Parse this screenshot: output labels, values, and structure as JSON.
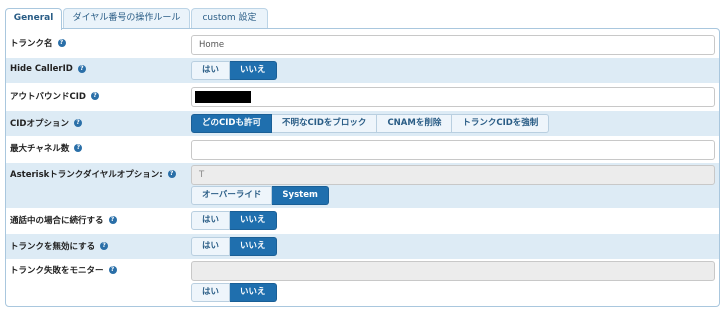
{
  "tabs": [
    {
      "label": "General",
      "active": true
    },
    {
      "label": "ダイヤル番号の操作ルール",
      "active": false
    },
    {
      "label": "custom 設定",
      "active": false
    }
  ],
  "fields": {
    "trunk_name": {
      "label": "トランク名",
      "value": "Home"
    },
    "hide_callerid": {
      "label": "Hide CallerID",
      "options": [
        "はい",
        "いいえ"
      ],
      "selected": "いいえ"
    },
    "outbound_cid": {
      "label": "アウトバウンドCID",
      "value": ""
    },
    "cid_option": {
      "label": "CIDオプション",
      "options": [
        "どのCIDも許可",
        "不明なCIDをブロック",
        "CNAMを削除",
        "トランクCIDを強制"
      ],
      "selected": "どのCIDも許可"
    },
    "max_channels": {
      "label": "最大チャネル数",
      "value": ""
    },
    "asterisk_dial_options": {
      "label": "Asteriskトランクダイヤルオプション:",
      "value": "T",
      "options": [
        "オーバーライド",
        "System"
      ],
      "selected": "System"
    },
    "continue_if_busy": {
      "label": "通話中の場合に続行する",
      "options": [
        "はい",
        "いいえ"
      ],
      "selected": "いいえ"
    },
    "disable_trunk": {
      "label": "トランクを無効にする",
      "options": [
        "はい",
        "いいえ"
      ],
      "selected": "いいえ"
    },
    "monitor_trunk_failures": {
      "label": "トランク失敗をモニター",
      "value": "",
      "options": [
        "はい",
        "いいえ"
      ],
      "selected": "いいえ"
    }
  },
  "help_icon_glyph": "?",
  "colors": {
    "accent": "#1f6fae",
    "row_shade": "#ddebf5",
    "tab_text": "#2a5d86"
  }
}
